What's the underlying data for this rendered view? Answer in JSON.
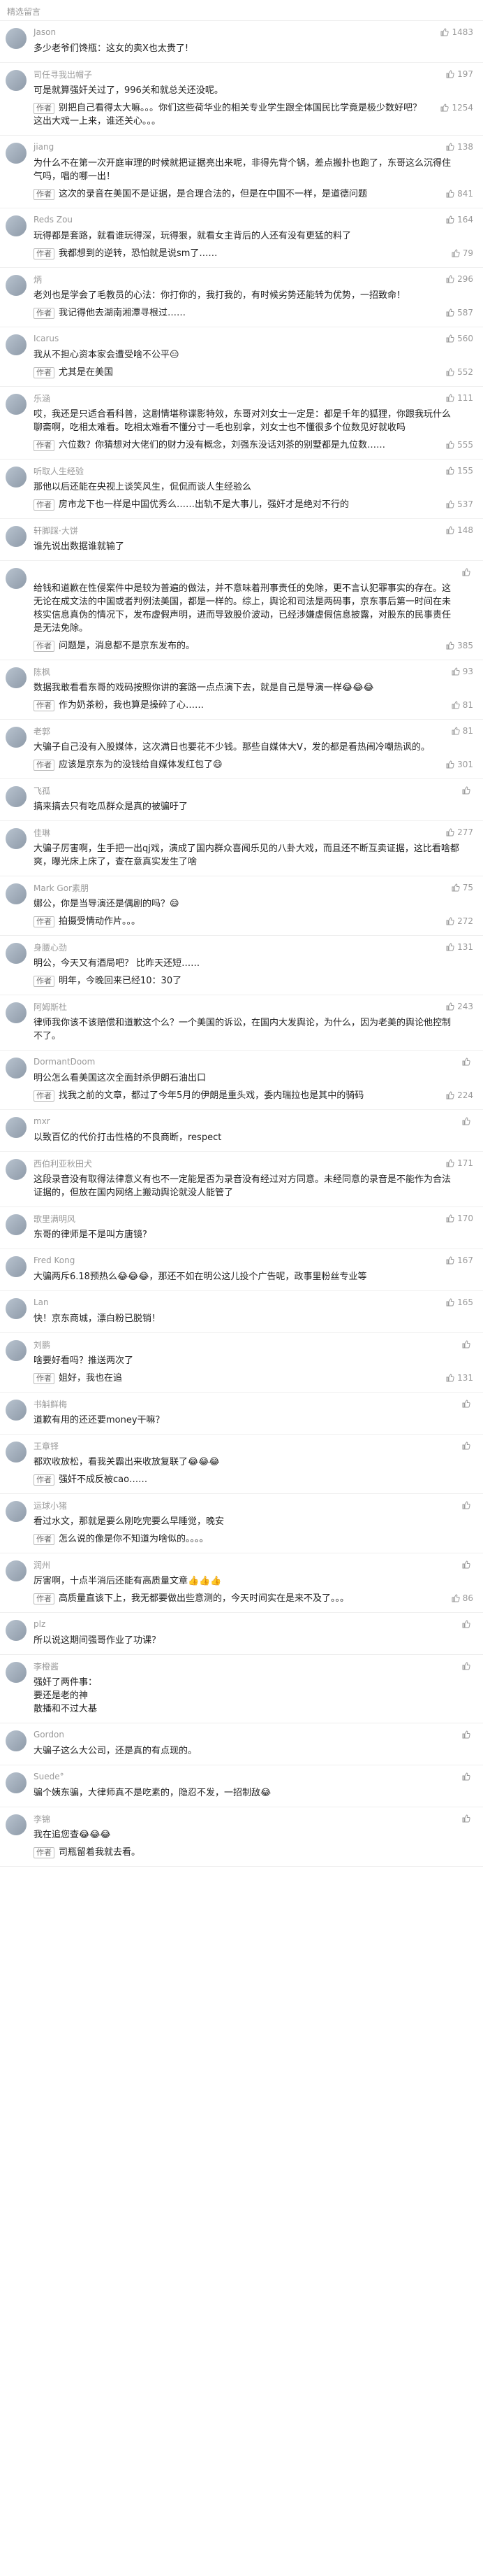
{
  "header": {
    "title": "精选留言"
  },
  "author_tag": "作者",
  "comments": [
    {
      "user": "Jason",
      "likes": "1483",
      "text": "多少老爷们馋瓶：这女的卖X也太贵了!",
      "reply": null,
      "reply_likes": null
    },
    {
      "user": "司任寻我出帽子",
      "likes": "197",
      "text": "可是就算强奸关过了，996关和就总关还没呢。",
      "reply": "别把自己看得太大嘛。。。你们这些荷华业的相关专业学生跟全体国民比学竟是极少数好吧？这出大戏一上来，谁还关心。。。",
      "reply_likes": "1254"
    },
    {
      "user": "jiang",
      "likes": "138",
      "text": "为什么不在第一次开庭审理的时候就把证据亮出来呢，非得先背个锅，差点搬扑也跑了，东哥这么沉得住气吗，唱的哪一出！",
      "reply": "这次的录音在美国不是证据，是合理合法的，但是在中国不一样，是道德问题",
      "reply_likes": "841"
    },
    {
      "user": "Reds Zou",
      "likes": "164",
      "text": "玩得都是套路，就看谁玩得深，玩得狠，就看女主背后的人还有没有更猛的料了",
      "reply": "我都想到的逆转，恐怕就是说sm了……",
      "reply_likes": "79"
    },
    {
      "user": "炳",
      "likes": "296",
      "text": "老刘也是学会了毛教员的心法：你打你的，我打我的，有时候劣势还能转为优势，一招致命！",
      "reply": "我记得他去湖南湘潭寻根过……",
      "reply_likes": "587"
    },
    {
      "user": "Icarus",
      "likes": "560",
      "text": "我从不担心资本家会遭受啥不公平😑",
      "reply": "尤其是在美国",
      "reply_likes": "552"
    },
    {
      "user": "乐涵",
      "likes": "111",
      "text": "哎，我还是只适合看科普，这剧情堪称谍影特效，东哥对刘女士一定是：都是千年的狐狸，你跟我玩什么聊斋啊，吃相太难看。吃相太难看不懂分寸一毛也别拿，刘女士也不懂很多个位数见好就收吗",
      "reply": "六位数？你猜想对大佬们的财力没有概念，刘强东没话刘茶的别墅都是九位数……",
      "reply_likes": "555"
    },
    {
      "user": "听取人生经验",
      "likes": "155",
      "text": "那他以后还能在央视上谈笑风生，侃侃而谈人生经验么",
      "reply": "房市龙下也一样是中国优秀么……出轨不是大事儿，强奸才是绝对不行的",
      "reply_likes": "537"
    },
    {
      "user": "轩脚踩·大饼",
      "likes": "148",
      "text": "谁先说出数据谁就输了",
      "reply": "",
      "reply_likes": ""
    },
    {
      "user": "",
      "likes": "",
      "text": "给钱和道歉在性侵案件中是较为普遍的做法，并不意味着刑事责任的免除，更不言认犯罪事实的存在。这无论在成文法的中国或者判例法美国，都是一样的。综上，舆论和司法是两码事，京东事后第一时间在未核实信息真伪的情况下，发布虚假声明，进而导致股价波动，已经涉嫌虚假信息披露，对股东的民事责任是无法免除。",
      "reply": "问题是，消息都不是京东发布的。",
      "reply_likes": "385"
    },
    {
      "user": "陈枫",
      "likes": "93",
      "text": "数据我敢看看东哥的戏码按照你讲的套路一点点演下去，就是自己是导演一样😂😂😂",
      "reply": "作为奶茶粉，我也算是操碎了心……",
      "reply_likes": "81"
    },
    {
      "user": "老郭",
      "likes": "81",
      "text": "大骗子自己没有入股媒体，这次满日也要花不少钱。那些自媒体大V，发的都是看热闹冷嘲热讽的。",
      "reply": "应该是京东为的没钱给自媒体发红包了😄",
      "reply_likes": "301"
    },
    {
      "user": "飞孤",
      "likes": "",
      "text": "搞来搞去只有吃瓜群众是真的被骗吁了",
      "reply": "",
      "reply_likes": ""
    },
    {
      "user": "佳琳",
      "likes": "277",
      "text": "大骗子厉害啊，生手把一出qj戏，演成了国内群众喜闻乐见的八卦大戏，而且还不断互卖证据，这比看啥都爽，曝光床上床了，查在意真实发生了啥",
      "reply": "",
      "reply_likes": ""
    },
    {
      "user": "Mark Gor素朋",
      "likes": "75",
      "text": "娜公，你是当导演还是偶剧的吗？😄",
      "reply": "拍摄受情动作片。。。",
      "reply_likes": "272"
    },
    {
      "user": "身腰心劲",
      "likes": "131",
      "text": "明公，今天又有酒局吧？ 比昨天还短……",
      "reply": "明年，今晚回来已经10：30了",
      "reply_likes": ""
    },
    {
      "user": "阿姆斯杜",
      "likes": "243",
      "text": "律师我你该不该赔偿和道歉这个么？一个美国的诉讼，在国内大发舆论，为什么，因为老美的舆论他控制不了。",
      "reply": "",
      "reply_likes": ""
    },
    {
      "user": "DormantDoom",
      "likes": "",
      "text": "明公怎么看美国这次全面封杀伊朗石油出口",
      "reply": "找我之前的文章，都过了今年5月的伊朗是重头戏，委内瑞拉也是其中的骑码",
      "reply_likes": "224"
    },
    {
      "user": "mxr",
      "likes": "",
      "text": "以致百亿的代价打击性格的不良商断，respect",
      "reply": "",
      "reply_likes": ""
    },
    {
      "user": "西伯利亚秋田犬",
      "likes": "171",
      "text": "这段录音没有取得法律意义有也不一定能是否为录音没有经过对方同意。未经同意的录音是不能作为合法证据的，但放在国内网络上搬动舆论就没人能管了",
      "reply": "",
      "reply_likes": ""
    },
    {
      "user": "歌里满明风",
      "likes": "170",
      "text": "东哥的律师是不是叫方唐镜?",
      "reply": "",
      "reply_likes": ""
    },
    {
      "user": "Fred Kong",
      "likes": "167",
      "text": "大骗两斥6.18预热么😂😂😂，那还不如在明公这儿投个广告呢，政事里粉丝专业等",
      "reply": "",
      "reply_likes": "131"
    },
    {
      "user": "Lan",
      "likes": "165",
      "text": "快！京东商城，漂白粉已脱销！",
      "reply": "",
      "reply_likes": ""
    },
    {
      "user": "刘鹏",
      "likes": "",
      "text": "啥要好看吗？推送两次了",
      "reply": "姐好，我也在追",
      "reply_likes": "131"
    },
    {
      "user": "书斛鲜梅",
      "likes": "",
      "text": "道歉有用的还还要money干嘛？",
      "reply": "",
      "reply_likes": ""
    },
    {
      "user": "王章铎",
      "likes": "",
      "text": "都欢收放松，看我关霸出来收放复联了😂😂😂",
      "reply": "强奸不成反被cao……",
      "reply_likes": ""
    },
    {
      "user": "运球小猪",
      "likes": "",
      "text": "看过水文，那就是要么刚吃完要么早睡觉，晚安",
      "reply": "怎么说的像是你不知道为啥似的。。。。",
      "reply_likes": ""
    },
    {
      "user": "润州",
      "likes": "",
      "text": "厉害啊，十点半消后还能有高质量文章👍👍👍",
      "reply": "高质量直该下上，我无都要做出些意测的，今天时间实在是来不及了。。。",
      "reply_likes": "86"
    },
    {
      "user": "plz",
      "likes": "",
      "text": "所以说这期间强哥作业了功课？",
      "reply": "",
      "reply_likes": ""
    },
    {
      "user": "李橙酱",
      "likes": "",
      "text": "强奸了两件事：\n要还是老的神\n散播和不过大基",
      "reply": "",
      "reply_likes": ""
    },
    {
      "user": "Gordon",
      "likes": "",
      "text": "大骗子这么大公司，还是真的有点现的。",
      "reply": "",
      "reply_likes": ""
    },
    {
      "user": "Suede°",
      "likes": "",
      "text": "骗个姨东骗，大律师真不是吃素的，隐忍不发，一招制敌😂",
      "reply": "",
      "reply_likes": ""
    },
    {
      "user": "李锦",
      "likes": "",
      "text": "我在追您查😂😂😂",
      "reply": "司瓶留着我就去看。",
      "reply_likes": ""
    }
  ]
}
